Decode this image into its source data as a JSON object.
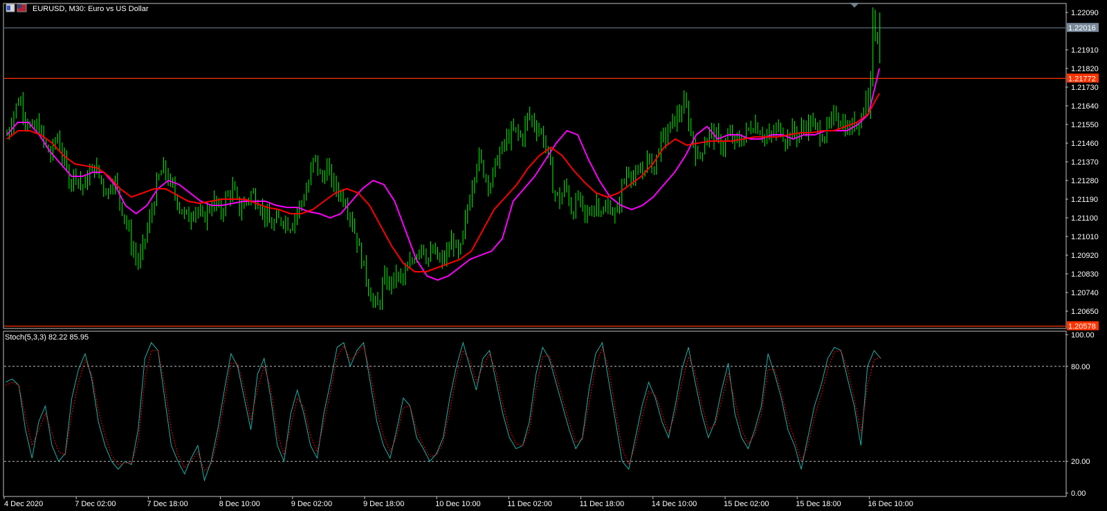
{
  "window": {
    "title": "EURUSD, M30:  Euro vs US Dollar"
  },
  "colors": {
    "background": "#000000",
    "grid_frame": "#c0c0c0",
    "bull_candle": "#00ff00",
    "ma_fast": "#ff00ff",
    "ma_slow": "#ff0000",
    "hline": "#ff3300",
    "stoch_main": "#20b2aa",
    "stoch_signal": "#ff0000",
    "text": "#ffffff",
    "bid_label_bg": "#778899",
    "hline_label_bg": "#ff3300"
  },
  "icons": [
    "chart-window-icon",
    "flag-eu-icon",
    "flag-us-icon",
    "scroll-marker-icon"
  ],
  "chart_data": [
    {
      "type": "candlestick",
      "title": "EURUSD, M30:  Euro vs US Dollar",
      "symbol": "EURUSD",
      "timeframe": "M30",
      "ylim": [
        1.2057,
        1.2213
      ],
      "y_ticks": [
        "1.22090",
        "1.21910",
        "1.21820",
        "1.21730",
        "1.21640",
        "1.21550",
        "1.21460",
        "1.21370",
        "1.21280",
        "1.21190",
        "1.21100",
        "1.21010",
        "1.20920",
        "1.20830",
        "1.20740",
        "1.20650"
      ],
      "y_tick_values": [
        1.2209,
        1.2191,
        1.2182,
        1.2173,
        1.2164,
        1.2155,
        1.2146,
        1.2137,
        1.2128,
        1.2119,
        1.211,
        1.2101,
        1.2092,
        1.2083,
        1.2074,
        1.2065
      ],
      "x_tick_labels": [
        "4 Dec 2020",
        "7 Dec 02:00",
        "7 Dec 18:00",
        "8 Dec 10:00",
        "9 Dec 02:00",
        "9 Dec 18:00",
        "10 Dec 10:00",
        "11 Dec 02:00",
        "11 Dec 18:00",
        "14 Dec 10:00",
        "15 Dec 02:00",
        "15 Dec 18:00",
        "16 Dec 10:00"
      ],
      "price_labels": [
        {
          "text": "1.22016",
          "value": 1.22016,
          "kind": "bid"
        },
        {
          "text": "1.21772",
          "value": 1.21772,
          "kind": "hline"
        },
        {
          "text": "1.20578",
          "value": 1.20578,
          "kind": "hline"
        }
      ],
      "horizontal_lines": [
        1.22016,
        1.21772,
        1.20578
      ],
      "close_path": [
        1.215,
        1.216,
        1.2168,
        1.2158,
        1.2152,
        1.2155,
        1.2145,
        1.214,
        1.215,
        1.2138,
        1.2128,
        1.2132,
        1.2124,
        1.213,
        1.2135,
        1.2128,
        1.2122,
        1.213,
        1.2118,
        1.2108,
        1.2095,
        1.2088,
        1.21,
        1.2112,
        1.2128,
        1.2134,
        1.2126,
        1.212,
        1.2112,
        1.211,
        1.2116,
        1.2108,
        1.2114,
        1.2118,
        1.2112,
        1.212,
        1.2124,
        1.2114,
        1.2118,
        1.2122,
        1.2118,
        1.2112,
        1.2106,
        1.2108,
        1.211,
        1.2106,
        1.2112,
        1.2118,
        1.2126,
        1.214,
        1.2128,
        1.2134,
        1.2126,
        1.2122,
        1.2118,
        1.2108,
        1.2096,
        1.2084,
        1.2072,
        1.2066,
        1.208,
        1.2078,
        1.2082,
        1.208,
        1.2086,
        1.2092,
        1.2098,
        1.209,
        1.2094,
        1.2088,
        1.2092,
        1.21,
        1.209,
        1.2108,
        1.2126,
        1.214,
        1.2132,
        1.2126,
        1.2138,
        1.2144,
        1.215,
        1.2152,
        1.2148,
        1.216,
        1.2155,
        1.2152,
        1.2143,
        1.2124,
        1.2118,
        1.2126,
        1.2112,
        1.212,
        1.211,
        1.2114,
        1.2118,
        1.2112,
        1.2116,
        1.211,
        1.2126,
        1.2134,
        1.2128,
        1.2132,
        1.2138,
        1.2134,
        1.2146,
        1.215,
        1.2156,
        1.216,
        1.2165,
        1.215,
        1.2138,
        1.2146,
        1.2152,
        1.2148,
        1.2144,
        1.215,
        1.2146,
        1.2148,
        1.2152,
        1.2156,
        1.2152,
        1.2148,
        1.215,
        1.2154,
        1.2148,
        1.2152,
        1.215,
        1.2154,
        1.2156,
        1.2152,
        1.215,
        1.2154,
        1.216,
        1.2156,
        1.2152,
        1.2156,
        1.2158,
        1.217,
        1.2204,
        1.2202
      ],
      "series": [
        {
          "name": "MA fast",
          "values": [
            1.215,
            1.2156,
            1.2156,
            1.215,
            1.2142,
            1.2136,
            1.213,
            1.213,
            1.2132,
            1.2132,
            1.2126,
            1.2116,
            1.2112,
            1.2116,
            1.2124,
            1.2128,
            1.2126,
            1.2122,
            1.2118,
            1.2116,
            1.2116,
            1.2117,
            1.2118,
            1.2118,
            1.2118,
            1.2116,
            1.2115,
            1.2115,
            1.2113,
            1.2112,
            1.211,
            1.2112,
            1.2118,
            1.2124,
            1.2128,
            1.2126,
            1.2118,
            1.2104,
            1.209,
            1.2082,
            1.208,
            1.2082,
            1.2086,
            1.209,
            1.2092,
            1.2094,
            1.21,
            1.2118,
            1.2124,
            1.213,
            1.2138,
            1.2146,
            1.2152,
            1.215,
            1.2138,
            1.2128,
            1.212,
            1.2116,
            1.2114,
            1.2116,
            1.212,
            1.2126,
            1.2132,
            1.214,
            1.215,
            1.2154,
            1.2148,
            1.215,
            1.215,
            1.2148,
            1.2148,
            1.215,
            1.215,
            1.2148,
            1.215,
            1.215,
            1.2152,
            1.2152,
            1.2152,
            1.2155,
            1.216,
            1.2182
          ]
        },
        {
          "name": "MA slow",
          "values": [
            1.2148,
            1.2152,
            1.2152,
            1.215,
            1.2146,
            1.214,
            1.2136,
            1.2135,
            1.2134,
            1.213,
            1.2124,
            1.212,
            1.2122,
            1.2124,
            1.2124,
            1.2121,
            1.2118,
            1.2117,
            1.2118,
            1.2119,
            1.2119,
            1.2119,
            1.2117,
            1.2115,
            1.2114,
            1.2112,
            1.2112,
            1.2114,
            1.2118,
            1.2122,
            1.2124,
            1.2122,
            1.2116,
            1.2106,
            1.2096,
            1.2088,
            1.2084,
            1.2084,
            1.2086,
            1.2088,
            1.209,
            1.2094,
            1.2104,
            1.2114,
            1.212,
            1.2126,
            1.2134,
            1.214,
            1.2144,
            1.214,
            1.2133,
            1.2127,
            1.2122,
            1.212,
            1.2122,
            1.2126,
            1.213,
            1.2136,
            1.2144,
            1.2148,
            1.2145,
            1.2146,
            1.2147,
            1.2147,
            1.2147,
            1.2148,
            1.2149,
            1.2149,
            1.2149,
            1.215,
            1.2151,
            1.2151,
            1.2152,
            1.2152,
            1.2154,
            1.2156,
            1.216,
            1.217
          ]
        }
      ]
    },
    {
      "type": "line",
      "title": "Stoch(5,3,3) 82.22 85.95",
      "ylim": [
        0,
        100
      ],
      "y_ticks": [
        "100.00",
        "80.00",
        "20.00",
        "0.00"
      ],
      "y_tick_values": [
        100,
        80,
        20,
        0
      ],
      "levels": [
        80,
        20
      ],
      "series": [
        {
          "name": "main",
          "values": [
            70,
            72,
            68,
            40,
            22,
            45,
            55,
            30,
            20,
            25,
            60,
            78,
            88,
            72,
            45,
            30,
            20,
            15,
            20,
            18,
            40,
            85,
            95,
            90,
            60,
            30,
            20,
            12,
            22,
            30,
            8,
            20,
            40,
            65,
            88,
            80,
            60,
            40,
            75,
            85,
            60,
            30,
            20,
            50,
            65,
            50,
            30,
            22,
            50,
            70,
            92,
            95,
            80,
            90,
            95,
            70,
            45,
            30,
            22,
            40,
            60,
            55,
            35,
            28,
            20,
            25,
            35,
            60,
            80,
            95,
            80,
            65,
            85,
            90,
            70,
            50,
            35,
            28,
            30,
            45,
            75,
            92,
            85,
            70,
            55,
            40,
            28,
            35,
            65,
            88,
            95,
            70,
            45,
            20,
            15,
            35,
            55,
            70,
            60,
            45,
            35,
            55,
            78,
            92,
            70,
            50,
            35,
            45,
            65,
            82,
            50,
            35,
            28,
            40,
            55,
            88,
            75,
            60,
            40,
            30,
            15,
            35,
            55,
            68,
            85,
            92,
            90,
            72,
            55,
            30,
            80,
            90,
            85
          ]
        },
        {
          "name": "signal",
          "values": [
            68,
            70,
            68,
            48,
            30,
            40,
            50,
            38,
            26,
            24,
            50,
            70,
            84,
            75,
            52,
            36,
            24,
            18,
            19,
            19,
            32,
            72,
            90,
            90,
            68,
            40,
            24,
            16,
            20,
            26,
            14,
            18,
            34,
            58,
            82,
            82,
            66,
            46,
            66,
            80,
            66,
            38,
            24,
            42,
            60,
            54,
            36,
            26,
            44,
            64,
            86,
            93,
            84,
            88,
            93,
            76,
            52,
            36,
            26,
            36,
            54,
            55,
            40,
            30,
            23,
            24,
            32,
            52,
            74,
            90,
            84,
            70,
            80,
            88,
            76,
            56,
            40,
            31,
            30,
            40,
            66,
            86,
            87,
            75,
            60,
            45,
            32,
            34,
            56,
            80,
            92,
            78,
            52,
            28,
            18,
            30,
            48,
            64,
            62,
            50,
            38,
            50,
            70,
            86,
            76,
            56,
            40,
            43,
            58,
            76,
            58,
            40,
            31,
            37,
            50,
            78,
            78,
            64,
            46,
            34,
            20,
            30,
            48,
            62,
            78,
            89,
            90,
            78,
            60,
            38,
            68,
            84,
            86
          ]
        }
      ]
    }
  ]
}
